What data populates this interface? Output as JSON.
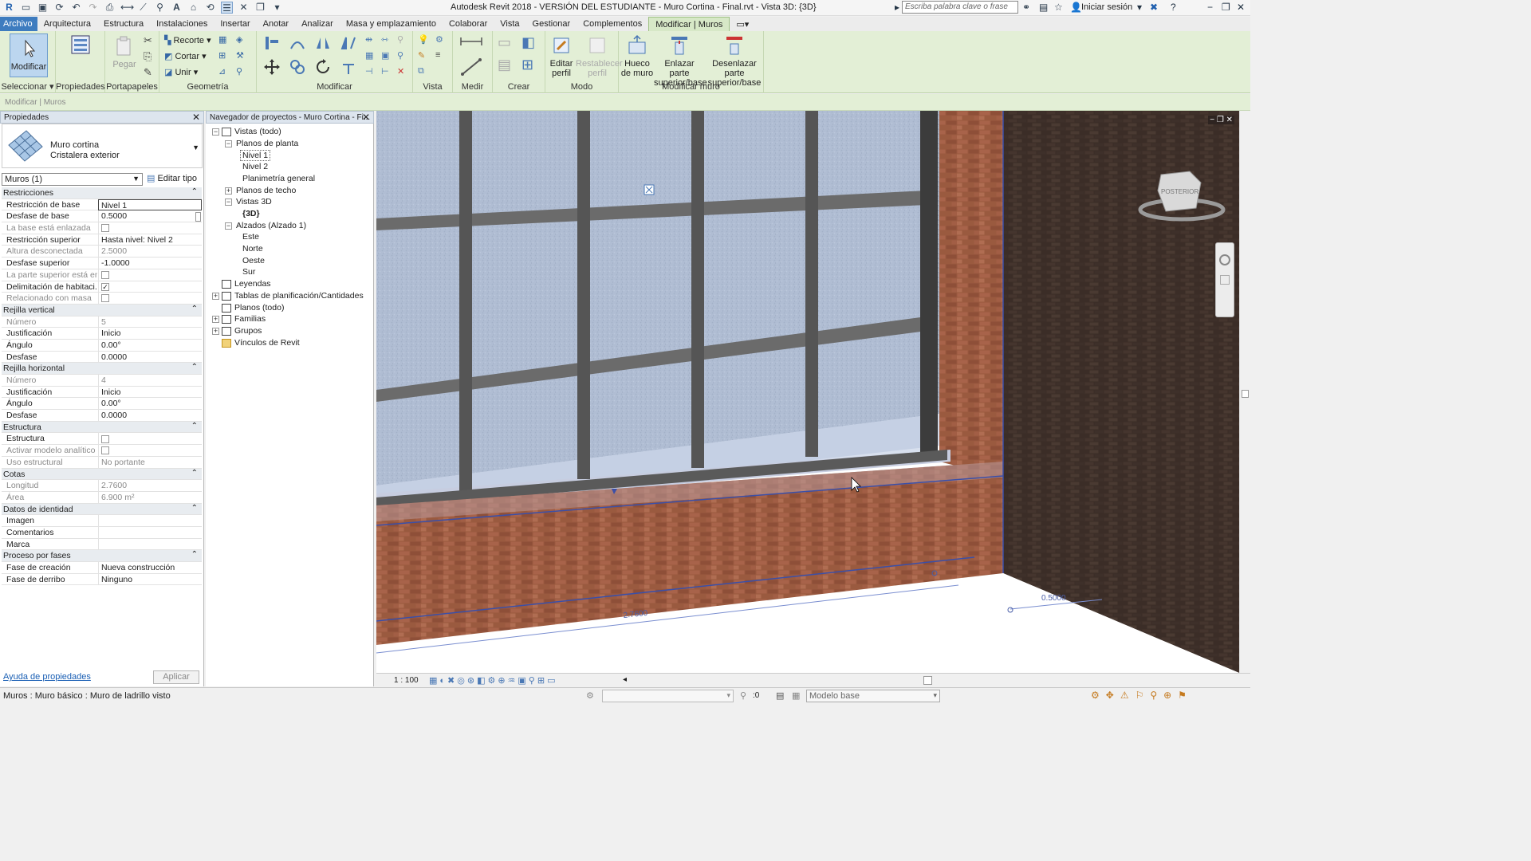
{
  "titlebar": {
    "title": "Autodesk Revit 2018 - VERSIÓN DEL ESTUDIANTE -    Muro Cortina - Final.rvt - Vista 3D: {3D}",
    "search_placeholder": "Escriba palabra clave o frase",
    "signin": "Iniciar sesión"
  },
  "tabs": [
    "Archivo",
    "Arquitectura",
    "Estructura",
    "Instalaciones",
    "Insertar",
    "Anotar",
    "Analizar",
    "Masa y emplazamiento",
    "Colaborar",
    "Vista",
    "Gestionar",
    "Complementos",
    "Modificar | Muros"
  ],
  "ribbon": {
    "modify": "Modificar",
    "select": "Seleccionar",
    "properties": "Propiedades",
    "paste": "Pegar",
    "clipboard": "Portapapeles",
    "cope": "Recorte",
    "cut": "Cortar",
    "join": "Unir",
    "geometry": "Geometría",
    "modify_group": "Modificar",
    "view": "Vista",
    "measure": "Medir",
    "create": "Crear",
    "edit_profile": [
      "Editar",
      "perfil"
    ],
    "reset_profile": [
      "Restablecer",
      "perfil"
    ],
    "mode": "Modo",
    "wall_opening": [
      "Hueco",
      "de muro"
    ],
    "attach": [
      "Enlazar parte",
      "superior/base"
    ],
    "detach": [
      "Desenlazar parte",
      "superior/base"
    ],
    "modify_wall": "Modificar muro"
  },
  "context_label": "Modificar | Muros",
  "properties": {
    "header": "Propiedades",
    "type_family": "Muro cortina",
    "type_name": "Cristalera exterior",
    "filter": "Muros (1)",
    "edit_type": "Editar tipo",
    "rows": [
      {
        "kind": "cat",
        "label": "Restricciones"
      },
      {
        "label": "Restricción de base",
        "value": "Nivel 1",
        "selected": true
      },
      {
        "label": "Desfase de base",
        "value": "0.5000"
      },
      {
        "label": "La base está enlazada",
        "check": false,
        "disabled": true
      },
      {
        "label": "Restricción superior",
        "value": "Hasta nivel: Nivel 2"
      },
      {
        "label": "Altura desconectada",
        "value": "2.5000",
        "disabled": true
      },
      {
        "label": "Desfase superior",
        "value": "-1.0000"
      },
      {
        "label": "La parte superior está enl...",
        "check": false,
        "disabled": true
      },
      {
        "label": "Delimitación de habitaci...",
        "check": true
      },
      {
        "label": "Relacionado con masa",
        "check": false,
        "disabled": true
      },
      {
        "kind": "cat",
        "label": "Rejilla vertical"
      },
      {
        "label": "Número",
        "value": "5",
        "disabled": true
      },
      {
        "label": "Justificación",
        "value": "Inicio"
      },
      {
        "label": "Ángulo",
        "value": "0.00°"
      },
      {
        "label": "Desfase",
        "value": "0.0000"
      },
      {
        "kind": "cat",
        "label": "Rejilla horizontal"
      },
      {
        "label": "Número",
        "value": "4",
        "disabled": true
      },
      {
        "label": "Justificación",
        "value": "Inicio"
      },
      {
        "label": "Ángulo",
        "value": "0.00°"
      },
      {
        "label": "Desfase",
        "value": "0.0000"
      },
      {
        "kind": "cat",
        "label": "Estructura"
      },
      {
        "label": "Estructura",
        "check": false
      },
      {
        "label": "Activar modelo analítico",
        "check": false,
        "disabled": true
      },
      {
        "label": "Uso estructural",
        "value": "No portante",
        "disabled": true
      },
      {
        "kind": "cat",
        "label": "Cotas"
      },
      {
        "label": "Longitud",
        "value": "2.7600",
        "disabled": true
      },
      {
        "label": "Área",
        "value": "6.900 m²",
        "disabled": true
      },
      {
        "kind": "cat",
        "label": "Datos de identidad"
      },
      {
        "label": "Imagen",
        "value": ""
      },
      {
        "label": "Comentarios",
        "value": ""
      },
      {
        "label": "Marca",
        "value": ""
      },
      {
        "kind": "cat",
        "label": "Proceso por fases"
      },
      {
        "label": "Fase de creación",
        "value": "Nueva construcción"
      },
      {
        "label": "Fase de derribo",
        "value": "Ninguno"
      }
    ],
    "help": "Ayuda de propiedades",
    "apply": "Aplicar"
  },
  "browser": {
    "header": "Navegador de proyectos - Muro Cortina - Fi...",
    "nodes": [
      {
        "label": "Vistas (todo)",
        "depth": 0,
        "box": "−",
        "icon": "views-icon"
      },
      {
        "label": "Planos de planta",
        "depth": 1,
        "box": "−"
      },
      {
        "label": "Nivel 1",
        "depth": 2,
        "selected": true
      },
      {
        "label": "Nivel 2",
        "depth": 2
      },
      {
        "label": "Planimetría general",
        "depth": 2
      },
      {
        "label": "Planos de techo",
        "depth": 1,
        "box": "+"
      },
      {
        "label": "Vistas 3D",
        "depth": 1,
        "box": "−"
      },
      {
        "label": "{3D}",
        "depth": 2,
        "bold": true
      },
      {
        "label": "Alzados (Alzado 1)",
        "depth": 1,
        "box": "−"
      },
      {
        "label": "Este",
        "depth": 2
      },
      {
        "label": "Norte",
        "depth": 2
      },
      {
        "label": "Oeste",
        "depth": 2
      },
      {
        "label": "Sur",
        "depth": 2
      },
      {
        "label": "Leyendas",
        "depth": 0,
        "icon": "legend-icon"
      },
      {
        "label": "Tablas de planificación/Cantidades",
        "depth": 0,
        "box": "+",
        "icon": "schedule-icon"
      },
      {
        "label": "Planos (todo)",
        "depth": 0,
        "icon": "sheet-icon"
      },
      {
        "label": "Familias",
        "depth": 0,
        "box": "+",
        "icon": "families-icon"
      },
      {
        "label": "Grupos",
        "depth": 0,
        "box": "+",
        "icon": "groups-icon"
      },
      {
        "label": "Vínculos de Revit",
        "depth": 0,
        "icon": "links-icon"
      }
    ]
  },
  "viewport": {
    "dim_length": "2.7600",
    "dim_offset": "0.5000",
    "viewcube": "POSTERIOR"
  },
  "viewbar": {
    "scale": "1 : 100"
  },
  "status": {
    "text": "Muros : Muro básico : Muro de ladrillo visto",
    "zero": ":0",
    "model": "Modelo base"
  }
}
